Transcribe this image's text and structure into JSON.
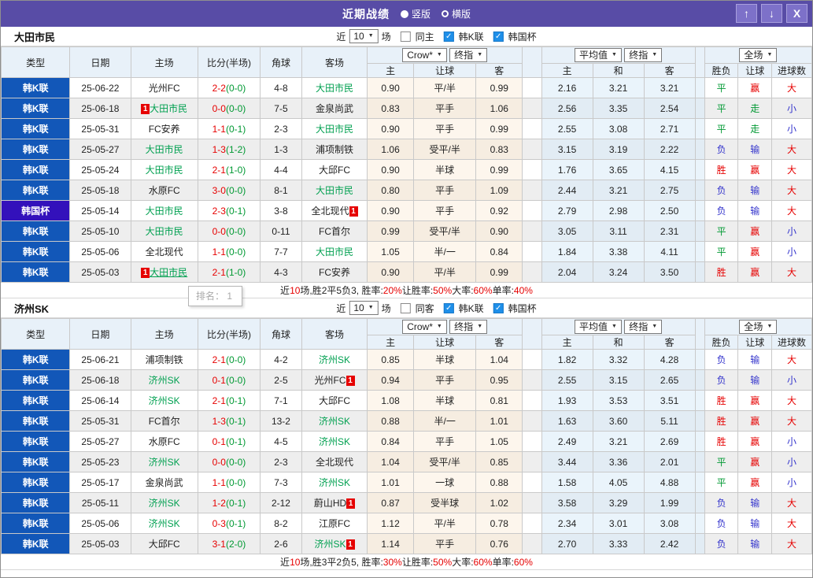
{
  "titlebar": {
    "title": "近期战绩",
    "layout_options": [
      {
        "label": "竖版",
        "selected": true
      },
      {
        "label": "横版",
        "selected": false
      }
    ],
    "window_buttons": [
      {
        "name": "move-up",
        "glyph": "↑"
      },
      {
        "name": "move-down",
        "glyph": "↓"
      },
      {
        "name": "close",
        "glyph": "X"
      }
    ]
  },
  "tooltip": {
    "text": "排名： 1"
  },
  "colors": {
    "titlebar": "#584ca6",
    "league_cell": "#1257b8",
    "cup_cell": "#3311bb",
    "focus_team": "#00a050",
    "win_red": "#e60000",
    "draw_green": "#009933",
    "lose_blue": "#3333cc",
    "crow_col_bg": "#fdf6ed",
    "avg_col_bg": "#eaf4fb"
  },
  "table_header": {
    "cols": [
      "类型",
      "日期",
      "主场",
      "比分(半场)",
      "角球",
      "客场"
    ],
    "crow_select": "Crow*",
    "crow_final_select": "终指",
    "crow_sub": [
      "主",
      "让球",
      "客"
    ],
    "avg_select": "平均值",
    "avg_final_select": "终指",
    "avg_sub": [
      "主",
      "和",
      "客"
    ],
    "full_select": "全场",
    "result_sub": [
      "胜负",
      "让球",
      "进球数"
    ]
  },
  "sections": [
    {
      "team": "大田市民",
      "controls": {
        "near": "近",
        "count": "10",
        "games": "场",
        "same": {
          "label": "同主",
          "checked": false
        },
        "league": {
          "label": "韩K联",
          "checked": true
        },
        "cup": {
          "label": "韩国杯",
          "checked": true
        }
      },
      "rows": [
        {
          "league": "韩K联",
          "is_cup": false,
          "date": "25-06-22",
          "home": "光州FC",
          "home_focus": false,
          "home_badge": "",
          "home_underline": false,
          "score": "2-2",
          "half": "(0-0)",
          "corners": "4-8",
          "away": "大田市民",
          "away_focus": true,
          "away_badge": "",
          "odds": [
            "0.90",
            "平/半",
            "0.99"
          ],
          "avg": [
            "2.16",
            "3.21",
            "3.21"
          ],
          "results": [
            "平",
            "赢",
            "大"
          ]
        },
        {
          "league": "韩K联",
          "is_cup": false,
          "date": "25-06-18",
          "home": "大田市民",
          "home_focus": true,
          "home_badge": "1",
          "home_underline": false,
          "score": "0-0",
          "half": "(0-0)",
          "corners": "7-5",
          "away": "金泉尚武",
          "away_focus": false,
          "away_badge": "",
          "odds": [
            "0.83",
            "平手",
            "1.06"
          ],
          "avg": [
            "2.56",
            "3.35",
            "2.54"
          ],
          "results": [
            "平",
            "走",
            "小"
          ]
        },
        {
          "league": "韩K联",
          "is_cup": false,
          "date": "25-05-31",
          "home": "FC安养",
          "home_focus": false,
          "home_badge": "",
          "home_underline": false,
          "score": "1-1",
          "half": "(0-1)",
          "corners": "2-3",
          "away": "大田市民",
          "away_focus": true,
          "away_badge": "",
          "odds": [
            "0.90",
            "平手",
            "0.99"
          ],
          "avg": [
            "2.55",
            "3.08",
            "2.71"
          ],
          "results": [
            "平",
            "走",
            "小"
          ]
        },
        {
          "league": "韩K联",
          "is_cup": false,
          "date": "25-05-27",
          "home": "大田市民",
          "home_focus": true,
          "home_badge": "",
          "home_underline": false,
          "score": "1-3",
          "half": "(1-2)",
          "corners": "1-3",
          "away": "浦项制铁",
          "away_focus": false,
          "away_badge": "",
          "odds": [
            "1.06",
            "受平/半",
            "0.83"
          ],
          "avg": [
            "3.15",
            "3.19",
            "2.22"
          ],
          "results": [
            "负",
            "输",
            "大"
          ]
        },
        {
          "league": "韩K联",
          "is_cup": false,
          "date": "25-05-24",
          "home": "大田市民",
          "home_focus": true,
          "home_badge": "",
          "home_underline": false,
          "score": "2-1",
          "half": "(1-0)",
          "corners": "4-4",
          "away": "大邱FC",
          "away_focus": false,
          "away_badge": "",
          "odds": [
            "0.90",
            "半球",
            "0.99"
          ],
          "avg": [
            "1.76",
            "3.65",
            "4.15"
          ],
          "results": [
            "胜",
            "赢",
            "大"
          ]
        },
        {
          "league": "韩K联",
          "is_cup": false,
          "date": "25-05-18",
          "home": "水原FC",
          "home_focus": false,
          "home_badge": "",
          "home_underline": false,
          "score": "3-0",
          "half": "(0-0)",
          "corners": "8-1",
          "away": "大田市民",
          "away_focus": true,
          "away_badge": "",
          "odds": [
            "0.80",
            "平手",
            "1.09"
          ],
          "avg": [
            "2.44",
            "3.21",
            "2.75"
          ],
          "results": [
            "负",
            "输",
            "大"
          ]
        },
        {
          "league": "韩国杯",
          "is_cup": true,
          "date": "25-05-14",
          "home": "大田市民",
          "home_focus": true,
          "home_badge": "",
          "home_underline": false,
          "score": "2-3",
          "half": "(0-1)",
          "corners": "3-8",
          "away": "全北现代",
          "away_focus": false,
          "away_badge": "1",
          "odds": [
            "0.90",
            "平手",
            "0.92"
          ],
          "avg": [
            "2.79",
            "2.98",
            "2.50"
          ],
          "results": [
            "负",
            "输",
            "大"
          ]
        },
        {
          "league": "韩K联",
          "is_cup": false,
          "date": "25-05-10",
          "home": "大田市民",
          "home_focus": true,
          "home_badge": "",
          "home_underline": false,
          "score": "0-0",
          "half": "(0-0)",
          "corners": "0-11",
          "away": "FC首尔",
          "away_focus": false,
          "away_badge": "",
          "odds": [
            "0.99",
            "受平/半",
            "0.90"
          ],
          "avg": [
            "3.05",
            "3.11",
            "2.31"
          ],
          "results": [
            "平",
            "赢",
            "小"
          ]
        },
        {
          "league": "韩K联",
          "is_cup": false,
          "date": "25-05-06",
          "home": "全北现代",
          "home_focus": false,
          "home_badge": "",
          "home_underline": false,
          "score": "1-1",
          "half": "(0-0)",
          "corners": "7-7",
          "away": "大田市民",
          "away_focus": true,
          "away_badge": "",
          "odds": [
            "1.05",
            "半/一",
            "0.84"
          ],
          "avg": [
            "1.84",
            "3.38",
            "4.11"
          ],
          "results": [
            "平",
            "赢",
            "小"
          ]
        },
        {
          "league": "韩K联",
          "is_cup": false,
          "date": "25-05-03",
          "home": "大田市民",
          "home_focus": true,
          "home_badge": "1",
          "home_underline": true,
          "score": "2-1",
          "half": "(1-0)",
          "corners": "4-3",
          "away": "FC安养",
          "away_focus": false,
          "away_badge": "",
          "odds": [
            "0.90",
            "平/半",
            "0.99"
          ],
          "avg": [
            "2.04",
            "3.24",
            "3.50"
          ],
          "results": [
            "胜",
            "赢",
            "大"
          ]
        }
      ],
      "summary": [
        {
          "text": "近",
          "red": false
        },
        {
          "text": "10",
          "red": true
        },
        {
          "text": "场,胜2平5负3, 胜率:",
          "red": false
        },
        {
          "text": "20%",
          "red": true
        },
        {
          "text": " 让胜率:",
          "red": false
        },
        {
          "text": "50%",
          "red": true
        },
        {
          "text": " 大率:",
          "red": false
        },
        {
          "text": "60%",
          "red": true
        },
        {
          "text": " 单率:",
          "red": false
        },
        {
          "text": "40%",
          "red": true
        }
      ]
    },
    {
      "team": "济州SK",
      "controls": {
        "near": "近",
        "count": "10",
        "games": "场",
        "same": {
          "label": "同客",
          "checked": false
        },
        "league": {
          "label": "韩K联",
          "checked": true
        },
        "cup": {
          "label": "韩国杯",
          "checked": true
        }
      },
      "rows": [
        {
          "league": "韩K联",
          "is_cup": false,
          "date": "25-06-21",
          "home": "浦项制铁",
          "home_focus": false,
          "home_badge": "",
          "home_underline": false,
          "score": "2-1",
          "half": "(0-0)",
          "corners": "4-2",
          "away": "济州SK",
          "away_focus": true,
          "away_badge": "",
          "odds": [
            "0.85",
            "半球",
            "1.04"
          ],
          "avg": [
            "1.82",
            "3.32",
            "4.28"
          ],
          "results": [
            "负",
            "输",
            "大"
          ]
        },
        {
          "league": "韩K联",
          "is_cup": false,
          "date": "25-06-18",
          "home": "济州SK",
          "home_focus": true,
          "home_badge": "",
          "home_underline": false,
          "score": "0-1",
          "half": "(0-0)",
          "corners": "2-5",
          "away": "光州FC",
          "away_focus": false,
          "away_badge": "1",
          "odds": [
            "0.94",
            "平手",
            "0.95"
          ],
          "avg": [
            "2.55",
            "3.15",
            "2.65"
          ],
          "results": [
            "负",
            "输",
            "小"
          ]
        },
        {
          "league": "韩K联",
          "is_cup": false,
          "date": "25-06-14",
          "home": "济州SK",
          "home_focus": true,
          "home_badge": "",
          "home_underline": false,
          "score": "2-1",
          "half": "(0-1)",
          "corners": "7-1",
          "away": "大邱FC",
          "away_focus": false,
          "away_badge": "",
          "odds": [
            "1.08",
            "半球",
            "0.81"
          ],
          "avg": [
            "1.93",
            "3.53",
            "3.51"
          ],
          "results": [
            "胜",
            "赢",
            "大"
          ]
        },
        {
          "league": "韩K联",
          "is_cup": false,
          "date": "25-05-31",
          "home": "FC首尔",
          "home_focus": false,
          "home_badge": "",
          "home_underline": false,
          "score": "1-3",
          "half": "(0-1)",
          "corners": "13-2",
          "away": "济州SK",
          "away_focus": true,
          "away_badge": "",
          "odds": [
            "0.88",
            "半/一",
            "1.01"
          ],
          "avg": [
            "1.63",
            "3.60",
            "5.11"
          ],
          "results": [
            "胜",
            "赢",
            "大"
          ]
        },
        {
          "league": "韩K联",
          "is_cup": false,
          "date": "25-05-27",
          "home": "水原FC",
          "home_focus": false,
          "home_badge": "",
          "home_underline": false,
          "score": "0-1",
          "half": "(0-1)",
          "corners": "4-5",
          "away": "济州SK",
          "away_focus": true,
          "away_badge": "",
          "odds": [
            "0.84",
            "平手",
            "1.05"
          ],
          "avg": [
            "2.49",
            "3.21",
            "2.69"
          ],
          "results": [
            "胜",
            "赢",
            "小"
          ]
        },
        {
          "league": "韩K联",
          "is_cup": false,
          "date": "25-05-23",
          "home": "济州SK",
          "home_focus": true,
          "home_badge": "",
          "home_underline": false,
          "score": "0-0",
          "half": "(0-0)",
          "corners": "2-3",
          "away": "全北现代",
          "away_focus": false,
          "away_badge": "",
          "odds": [
            "1.04",
            "受平/半",
            "0.85"
          ],
          "avg": [
            "3.44",
            "3.36",
            "2.01"
          ],
          "results": [
            "平",
            "赢",
            "小"
          ]
        },
        {
          "league": "韩K联",
          "is_cup": false,
          "date": "25-05-17",
          "home": "金泉尚武",
          "home_focus": false,
          "home_badge": "",
          "home_underline": false,
          "score": "1-1",
          "half": "(0-0)",
          "corners": "7-3",
          "away": "济州SK",
          "away_focus": true,
          "away_badge": "",
          "odds": [
            "1.01",
            "一球",
            "0.88"
          ],
          "avg": [
            "1.58",
            "4.05",
            "4.88"
          ],
          "results": [
            "平",
            "赢",
            "小"
          ]
        },
        {
          "league": "韩K联",
          "is_cup": false,
          "date": "25-05-11",
          "home": "济州SK",
          "home_focus": true,
          "home_badge": "",
          "home_underline": false,
          "score": "1-2",
          "half": "(0-1)",
          "corners": "2-12",
          "away": "蔚山HD",
          "away_focus": false,
          "away_badge": "1",
          "odds": [
            "0.87",
            "受半球",
            "1.02"
          ],
          "avg": [
            "3.58",
            "3.29",
            "1.99"
          ],
          "results": [
            "负",
            "输",
            "大"
          ]
        },
        {
          "league": "韩K联",
          "is_cup": false,
          "date": "25-05-06",
          "home": "济州SK",
          "home_focus": true,
          "home_badge": "",
          "home_underline": false,
          "score": "0-3",
          "half": "(0-1)",
          "corners": "8-2",
          "away": "江原FC",
          "away_focus": false,
          "away_badge": "",
          "odds": [
            "1.12",
            "平/半",
            "0.78"
          ],
          "avg": [
            "2.34",
            "3.01",
            "3.08"
          ],
          "results": [
            "负",
            "输",
            "大"
          ]
        },
        {
          "league": "韩K联",
          "is_cup": false,
          "date": "25-05-03",
          "home": "大邱FC",
          "home_focus": false,
          "home_badge": "",
          "home_underline": false,
          "score": "3-1",
          "half": "(2-0)",
          "corners": "2-6",
          "away": "济州SK",
          "away_focus": true,
          "away_badge": "1",
          "odds": [
            "1.14",
            "平手",
            "0.76"
          ],
          "avg": [
            "2.70",
            "3.33",
            "2.42"
          ],
          "results": [
            "负",
            "输",
            "大"
          ]
        }
      ],
      "summary": [
        {
          "text": "近",
          "red": false
        },
        {
          "text": "10",
          "red": true
        },
        {
          "text": "场,胜3平2负5, 胜率:",
          "red": false
        },
        {
          "text": "30%",
          "red": true
        },
        {
          "text": " 让胜率:",
          "red": false
        },
        {
          "text": "50%",
          "red": true
        },
        {
          "text": " 大率:",
          "red": false
        },
        {
          "text": "60%",
          "red": true
        },
        {
          "text": " 单率:",
          "red": false
        },
        {
          "text": "60%",
          "red": true
        }
      ]
    }
  ]
}
